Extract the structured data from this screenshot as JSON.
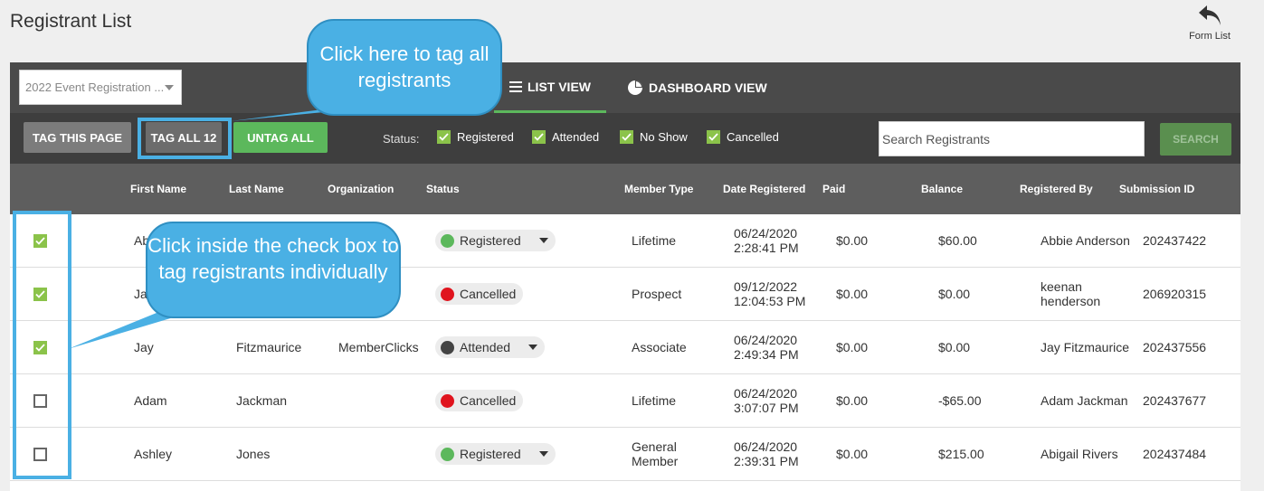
{
  "page_title": "Registrant List",
  "form_list": {
    "label": "Form List",
    "icon": "undo-arrow-icon"
  },
  "event_select": {
    "value": "2022 Event Registration ..."
  },
  "tabs": [
    {
      "label": "LIST VIEW",
      "icon": "list-icon",
      "active": true
    },
    {
      "label": "DASHBOARD VIEW",
      "icon": "pie-chart-icon",
      "active": false
    }
  ],
  "toolbar": {
    "tag_page": "TAG THIS PAGE",
    "tag_all": "TAG ALL 12",
    "untag_all": "UNTAG ALL",
    "status_label": "Status:",
    "status_filters": [
      "Registered",
      "Attended",
      "No Show",
      "Cancelled"
    ],
    "search_placeholder": "Search Registrants",
    "search_button": "SEARCH"
  },
  "columns": [
    "First Name",
    "Last Name",
    "Organization",
    "Status",
    "Member Type",
    "Date Registered",
    "Paid",
    "Balance",
    "Registered By",
    "Submission ID"
  ],
  "rows": [
    {
      "checked": true,
      "first": "Abbie",
      "last": "Anderson",
      "org": "",
      "status": "Registered",
      "status_color": "#5cb85c",
      "has_dropdown": true,
      "member_type": "Lifetime",
      "date1": "06/24/2020",
      "date2": "2:28:41 PM",
      "paid": "$0.00",
      "balance": "$60.00",
      "registered_by": "Abbie Anderson",
      "submission_id": "202437422"
    },
    {
      "checked": true,
      "first": "Jack",
      "last": "",
      "org": "",
      "status": "Cancelled",
      "status_color": "#e0141e",
      "has_dropdown": false,
      "member_type": "Prospect",
      "date1": "09/12/2022",
      "date2": "12:04:53 PM",
      "paid": "$0.00",
      "balance": "$0.00",
      "registered_by": "keenan henderson",
      "submission_id": "206920315"
    },
    {
      "checked": true,
      "first": "Jay",
      "last": "Fitzmaurice",
      "org": "MemberClicks",
      "status": "Attended",
      "status_color": "#444444",
      "has_dropdown": true,
      "member_type": "Associate",
      "date1": "06/24/2020",
      "date2": "2:49:34 PM",
      "paid": "$0.00",
      "balance": "$0.00",
      "registered_by": "Jay Fitzmaurice",
      "submission_id": "202437556"
    },
    {
      "checked": false,
      "first": "Adam",
      "last": "Jackman",
      "org": "",
      "status": "Cancelled",
      "status_color": "#e0141e",
      "has_dropdown": false,
      "member_type": "Lifetime",
      "date1": "06/24/2020",
      "date2": "3:07:07 PM",
      "paid": "$0.00",
      "balance": "-$65.00",
      "registered_by": "Adam Jackman",
      "submission_id": "202437677"
    },
    {
      "checked": false,
      "first": "Ashley",
      "last": "Jones",
      "org": "",
      "status": "Registered",
      "status_color": "#5cb85c",
      "has_dropdown": true,
      "member_type": "General Member",
      "date1": "06/24/2020",
      "date2": "2:39:31 PM",
      "paid": "$0.00",
      "balance": "$215.00",
      "registered_by": "Abigail Rivers",
      "submission_id": "202437484"
    }
  ],
  "callouts": {
    "tag_all": "Click here to tag all registrants",
    "checkbox": "Click inside the check box to tag registrants individually"
  },
  "colors": {
    "accent_green": "#5cb85c",
    "checkbox_green": "#8bc34a",
    "callout_blue": "#4ab0e4"
  }
}
